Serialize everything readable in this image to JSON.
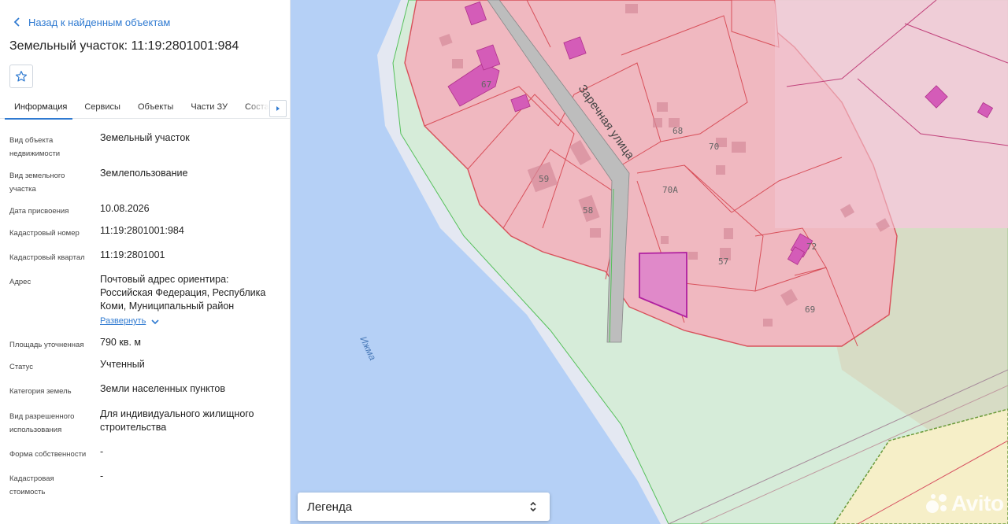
{
  "panel": {
    "back_label": "Назад к найденным объектам",
    "title": "Земельный участок: 11:19:2801001:984",
    "tabs": [
      {
        "label": "Информация"
      },
      {
        "label": "Сервисы"
      },
      {
        "label": "Объекты"
      },
      {
        "label": "Части ЗУ"
      },
      {
        "label": "Состав"
      }
    ],
    "fields": [
      {
        "label": "Вид объекта недвижимости",
        "value": "Земельный участок"
      },
      {
        "label": "Вид земельного участка",
        "value": "Землепользование"
      },
      {
        "label": "Дата присвоения",
        "value": "10.08.2026"
      },
      {
        "label": "Кадастровый номер",
        "value": "11:19:2801001:984"
      },
      {
        "label": "Кадастровый квартал",
        "value": "11:19:2801001"
      },
      {
        "label": "Адрес",
        "value": "Почтовый адрес ориентира: Российская Федерация, Республика Коми, Муниципальный район"
      },
      {
        "label": "Площадь уточненная",
        "value": "790 кв. м"
      },
      {
        "label": "Статус",
        "value": "Учтенный"
      },
      {
        "label": "Категория земель",
        "value": "Земли населенных пунктов"
      },
      {
        "label": "Вид разрешенного использования",
        "value": "Для индивидуального жилищного строительства"
      },
      {
        "label": "Форма собственности",
        "value": "-"
      },
      {
        "label": "Кадастровая стоимость",
        "value": "-"
      }
    ],
    "expand_label": "Развернуть"
  },
  "map": {
    "street_label": "Заречная улица",
    "river_label": "Ижма",
    "parcel_numbers": [
      "67",
      "68",
      "70",
      "70А",
      "59",
      "58",
      "57",
      "72",
      "69"
    ],
    "legend_label": "Легенда",
    "watermark": "Avito",
    "colors": {
      "water": "#b5d0f6",
      "green_zone": "#d6ecd9",
      "parcel_fill": "#f0b8c0",
      "parcel_stroke": "#d8505a",
      "selected_stroke": "#b020a0",
      "building": "#d660b8",
      "road": "#bdbdbd",
      "accent": "#2f7ad1"
    }
  }
}
